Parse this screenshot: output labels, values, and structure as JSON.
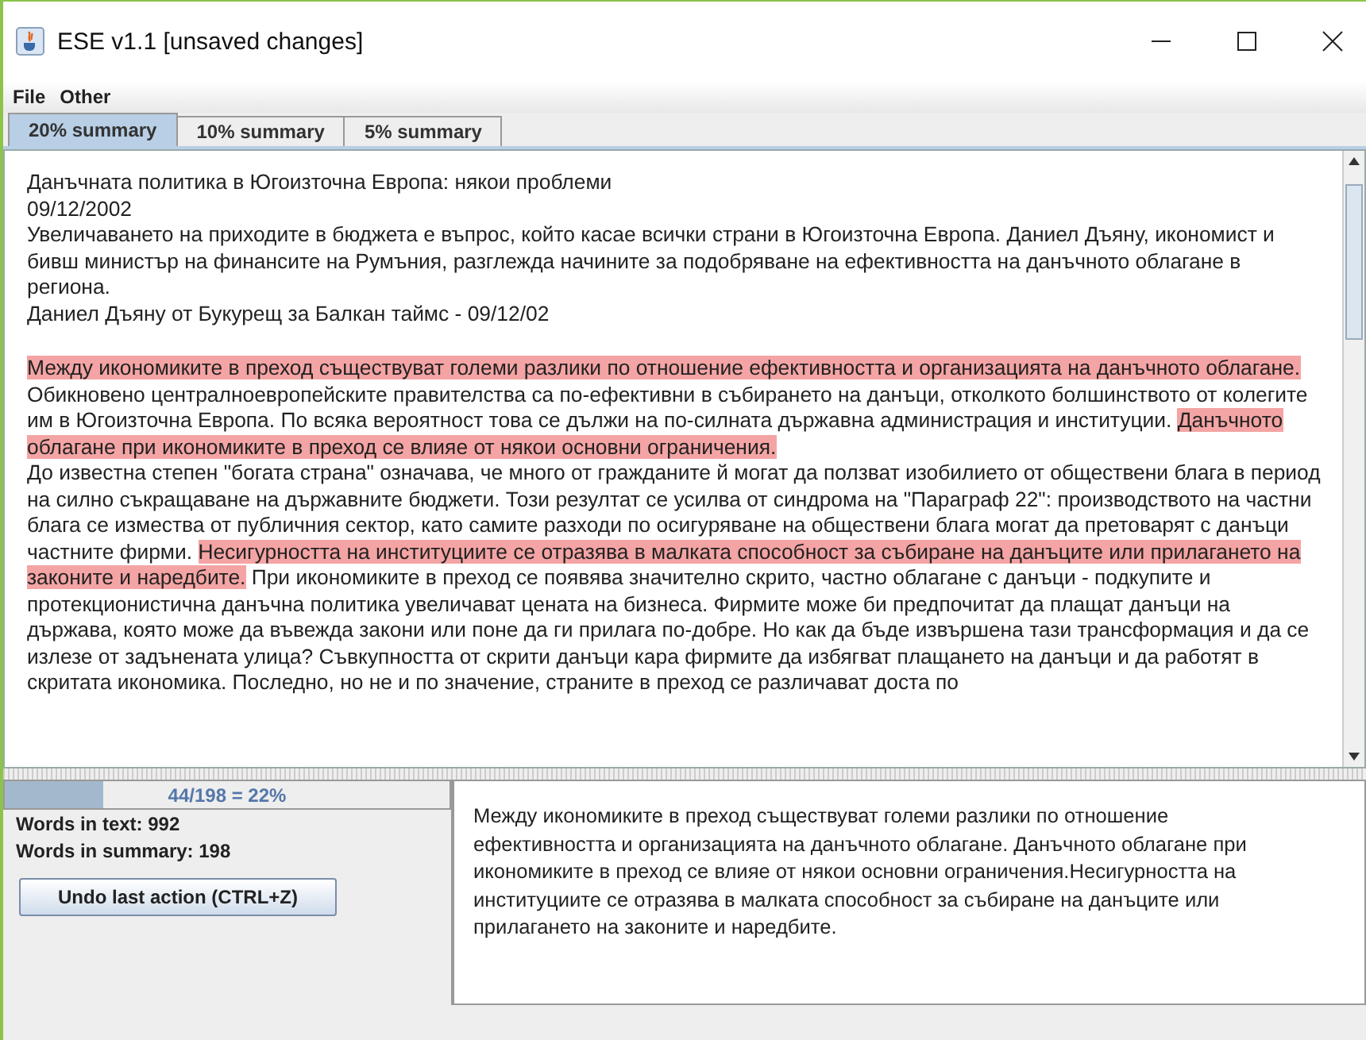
{
  "window": {
    "title": "ESE v1.1 [unsaved changes]"
  },
  "menu": [
    "File",
    "Other"
  ],
  "tabs": [
    {
      "label": "20% summary",
      "selected": true
    },
    {
      "label": "10% summary",
      "selected": false
    },
    {
      "label": "5% summary",
      "selected": false
    }
  ],
  "document": {
    "header": [
      "Данъчната политика в Югоизточна Европа: някои проблеми",
      "09/12/2002",
      "Увеличаването на приходите в бюджета е въпрос, който касае всички страни в Югоизточна Европа. Даниел Дъяну, икономист и бивш министър на финансите на Румъния, разглежда начините за подобряване на ефективността на данъчното облагане в региона.",
      "Даниел Дъяну от Букурещ за Балкан таймс - 09/12/02"
    ],
    "body": [
      [
        {
          "text": "Между икономиките в преход съществуват големи разлики по отношение ефективността и организацията на данъчното облагане.",
          "highlighted": true
        },
        {
          "text": " Обикновено централноевропейските правителства са по-ефективни в събирането на данъци, отколкото болшинството от колегите им в Югоизточна Европа. По всяка вероятност това се дължи на по-силната държавна администрация и институции. ",
          "highlighted": false
        },
        {
          "text": "Данъчното облагане при икономиките в преход се влияе от някои основни ограничения.",
          "highlighted": true
        }
      ],
      [
        {
          "text": "До известна степен \"богата страна\" означава, че много от гражданите й могат да ползват изобилието от обществени блага в период на силно съкращаване на държавните бюджети. Този резултат се усилва от синдрома на \"Параграф 22\": производството на частни блага се измества от публичния сектор, като самите разходи по осигуряване на обществени блага могат да претоварят с данъци частните фирми. ",
          "highlighted": false
        },
        {
          "text": "Несигурността на институциите се отразява в малката способност за събиране на данъците или прилагането на законите и наредбите.",
          "highlighted": true
        },
        {
          "text": " При икономиките в преход се появява значително скрито, частно облагане с данъци - подкупите и протекционистична данъчна политика увеличават цената на бизнеса. Фирмите може би предпочитат да плащат данъци на държава, която може да въвежда закони или поне да ги прилага по-добре. Но как да бъде извършена тази трансформация и да се излезе от задънената улица? Съвкупността от скрити данъци кара фирмите да избягват плащането на данъци и да работят в скритата икономика. Последно, но не и по значение, страните в преход се различават доста по",
          "highlighted": false
        }
      ]
    ]
  },
  "stats": {
    "progress_label": "44/198 = 22%",
    "level": 0.22,
    "words_in_text": "Words in text: 992",
    "words_in_summary": "Words in summary: 198"
  },
  "undo_button": "Undo last action (CTRL+Z)",
  "summary": "Между икономиките в преход съществуват големи разлики по отношение ефективността и организацията на данъчното облагане. Данъчното облагане при икономиките в преход се влияе от някои основни ограничения.Несигурността на институциите се отразява в малката способност за събиране на данъците или прилагането на законите и наредбите."
}
